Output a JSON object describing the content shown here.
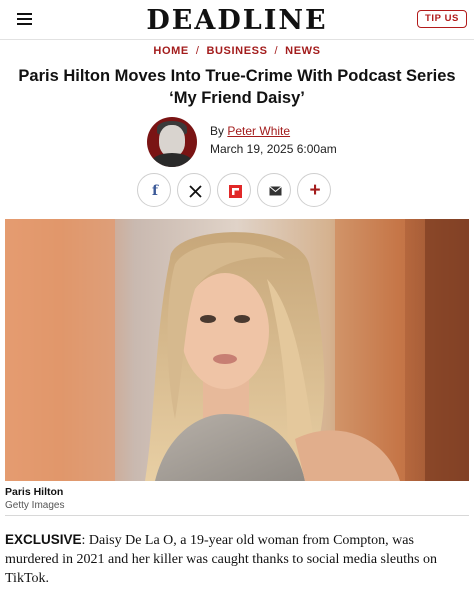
{
  "header": {
    "logo": "DEADLINE",
    "tip_button": "TIP US"
  },
  "breadcrumb": {
    "items": [
      "HOME",
      "BUSINESS",
      "NEWS"
    ],
    "separator": "/"
  },
  "article": {
    "headline": "Paris Hilton Moves Into True-Crime With Podcast Series ‘My Friend Daisy’",
    "byline_prefix": "By",
    "author": "Peter White",
    "date": "March 19, 2025 6:00am",
    "image_caption": "Paris Hilton",
    "image_credit": "Getty Images",
    "lead_label": "EXCLUSIVE",
    "lead_text": ": Daisy De La O, a 19-year old woman from Compton, was murdered in 2021 and her killer was caught thanks to social media sleuths on TikTok."
  },
  "share": {
    "icons": [
      "facebook-icon",
      "x-icon",
      "flipboard-icon",
      "email-icon",
      "more-icon"
    ]
  },
  "colors": {
    "accent": "#a31c1c",
    "text": "#111111"
  }
}
